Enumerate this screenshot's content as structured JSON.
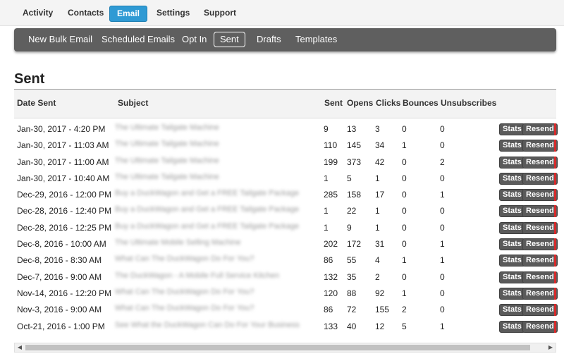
{
  "topnav": {
    "items": [
      {
        "label": "Activity"
      },
      {
        "label": "Contacts"
      },
      {
        "label": "Email",
        "active": true
      },
      {
        "label": "Settings"
      },
      {
        "label": "Support"
      }
    ]
  },
  "subnav": {
    "items": [
      {
        "label": "New Bulk Email"
      },
      {
        "label": "Scheduled Emails"
      },
      {
        "label": "Opt In"
      },
      {
        "label": "Sent",
        "active": true
      },
      {
        "label": "Drafts"
      },
      {
        "label": "Templates"
      }
    ]
  },
  "page": {
    "title": "Sent"
  },
  "table": {
    "headers": {
      "date": "Date Sent",
      "subject": "Subject",
      "sent": "Sent",
      "opens": "Opens",
      "clicks": "Clicks",
      "bounces": "Bounces",
      "unsubscribes": "Unsubscribes"
    },
    "actions": {
      "stats": "Stats",
      "resend": "Resend"
    },
    "rows": [
      {
        "date": "Jan-30, 2017 - 4:20 PM",
        "subject": "The Ultimate Tailgate Machine",
        "sent": "9",
        "opens": "13",
        "clicks": "3",
        "bounces": "0",
        "unsubscribes": "0"
      },
      {
        "date": "Jan-30, 2017 - 11:03 AM",
        "subject": "The Ultimate Tailgate Machine",
        "sent": "110",
        "opens": "145",
        "clicks": "34",
        "bounces": "1",
        "unsubscribes": "0"
      },
      {
        "date": "Jan-30, 2017 - 11:00 AM",
        "subject": "The Ultimate Tailgate Machine",
        "sent": "199",
        "opens": "373",
        "clicks": "42",
        "bounces": "0",
        "unsubscribes": "2"
      },
      {
        "date": "Jan-30, 2017 - 10:40 AM",
        "subject": "The Ultimate Tailgate Machine",
        "sent": "1",
        "opens": "5",
        "clicks": "1",
        "bounces": "0",
        "unsubscribes": "0"
      },
      {
        "date": "Dec-29, 2016 - 12:00 PM",
        "subject": "Buy a DuckWagon and Get a FREE Tailgate Package",
        "sent": "285",
        "opens": "158",
        "clicks": "17",
        "bounces": "0",
        "unsubscribes": "1"
      },
      {
        "date": "Dec-28, 2016 - 12:40 PM",
        "subject": "Buy a DuckWagon and Get a FREE Tailgate Package",
        "sent": "1",
        "opens": "22",
        "clicks": "1",
        "bounces": "0",
        "unsubscribes": "0"
      },
      {
        "date": "Dec-28, 2016 - 12:25 PM",
        "subject": "Buy a DuckWagon and Get a FREE Tailgate Package",
        "sent": "1",
        "opens": "9",
        "clicks": "1",
        "bounces": "0",
        "unsubscribes": "0"
      },
      {
        "date": "Dec-8, 2016 - 10:00 AM",
        "subject": "The Ultimate Mobile Selling Machine",
        "sent": "202",
        "opens": "172",
        "clicks": "31",
        "bounces": "0",
        "unsubscribes": "1"
      },
      {
        "date": "Dec-8, 2016 - 8:30 AM",
        "subject": "What Can The DuckWagon Do For You?",
        "sent": "86",
        "opens": "55",
        "clicks": "4",
        "bounces": "1",
        "unsubscribes": "1"
      },
      {
        "date": "Dec-7, 2016 - 9:00 AM",
        "subject": "The DuckWagon - A Mobile Full Service Kitchen",
        "sent": "132",
        "opens": "35",
        "clicks": "2",
        "bounces": "0",
        "unsubscribes": "0"
      },
      {
        "date": "Nov-14, 2016 - 12:20 PM",
        "subject": "What Can The DuckWagon Do For You?",
        "sent": "120",
        "opens": "88",
        "clicks": "92",
        "bounces": "1",
        "unsubscribes": "0"
      },
      {
        "date": "Nov-3, 2016 - 9:00 AM",
        "subject": "What Can The DuckWagon Do For You?",
        "sent": "86",
        "opens": "72",
        "clicks": "155",
        "bounces": "2",
        "unsubscribes": "0"
      },
      {
        "date": "Oct-21, 2016 - 1:00 PM",
        "subject": "See What the DuckWagon Can Do For Your Business",
        "sent": "133",
        "opens": "40",
        "clicks": "12",
        "bounces": "5",
        "unsubscribes": "1"
      }
    ]
  },
  "scrollbar": {
    "left_icon": "scroll-left-arrow-icon",
    "right_icon": "scroll-right-arrow-icon"
  },
  "colors": {
    "accent": "#2f9ad4",
    "subnav_bg": "#5f5f5f",
    "button_bg": "#5a5a5a",
    "edge_red": "#d52a2a"
  }
}
